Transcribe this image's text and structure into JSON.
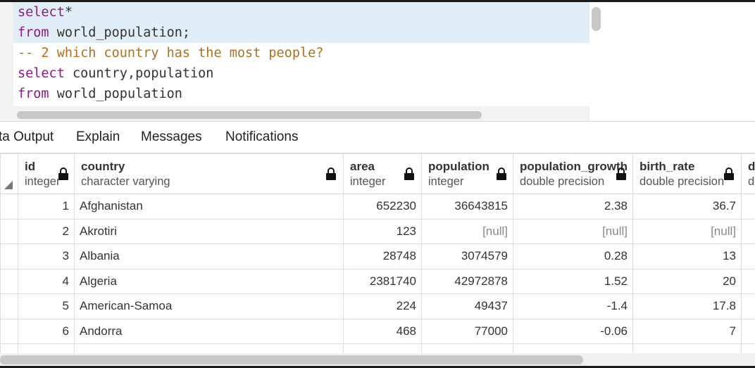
{
  "editor": {
    "lines": [
      {
        "keyword": "select",
        "rest": "*",
        "active": true,
        "comment": false
      },
      {
        "keyword": "from",
        "rest": " world_population;",
        "active": true,
        "comment": false
      },
      {
        "keyword": "",
        "rest": "-- 2 which country has the most people?",
        "active": false,
        "comment": true
      },
      {
        "keyword": "select",
        "rest": " country,population",
        "active": false,
        "comment": false
      },
      {
        "keyword": "from",
        "rest": " world_population",
        "active": false,
        "comment": false
      }
    ]
  },
  "tabs": [
    "ta Output",
    "Explain",
    "Messages",
    "Notifications"
  ],
  "active_tab": "ta Output",
  "columns": [
    {
      "name": "id",
      "type": "integer"
    },
    {
      "name": "country",
      "type": "character varying"
    },
    {
      "name": "area",
      "type": "integer"
    },
    {
      "name": "population",
      "type": "integer"
    },
    {
      "name": "population_growth",
      "type": "double precision"
    },
    {
      "name": "birth_rate",
      "type": "double precision"
    },
    {
      "name": "de",
      "type": "do"
    }
  ],
  "rows": [
    [
      "1",
      "Afghanistan",
      "652230",
      "36643815",
      "2.38",
      "36.7"
    ],
    [
      "2",
      "Akrotiri",
      "123",
      "[null]",
      "[null]",
      "[null]"
    ],
    [
      "3",
      "Albania",
      "28748",
      "3074579",
      "0.28",
      "13"
    ],
    [
      "4",
      "Algeria",
      "2381740",
      "42972878",
      "1.52",
      "20"
    ],
    [
      "5",
      "American-Samoa",
      "224",
      "49437",
      "-1.4",
      "17.8"
    ],
    [
      "6",
      "Andorra",
      "468",
      "77000",
      "-0.06",
      "7"
    ]
  ],
  "colors": {
    "accent": "#326690",
    "keyword": "#8b1a8b",
    "comment": "#b26f1a",
    "null_text": "#888888"
  }
}
